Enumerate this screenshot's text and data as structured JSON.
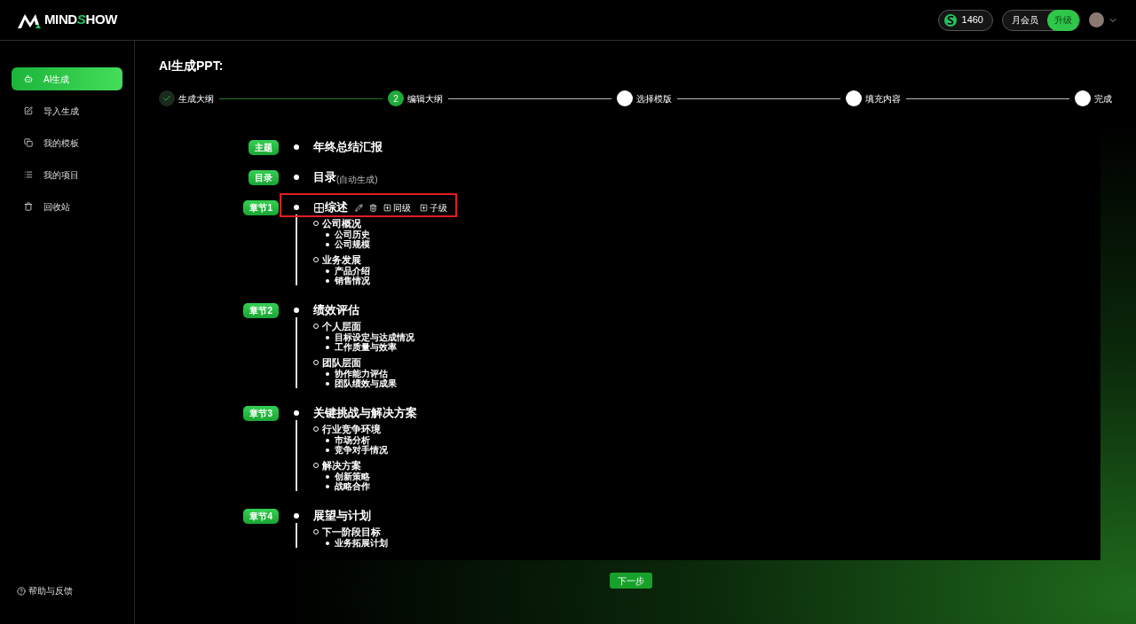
{
  "header": {
    "logo_text": "MINDSHOW",
    "coins": "1460",
    "membership": "月会员",
    "upgrade": "升级"
  },
  "sidebar": {
    "items": [
      {
        "label": "AI生成",
        "selected": true
      },
      {
        "label": "导入生成",
        "selected": false
      },
      {
        "label": "我的模板",
        "selected": false
      },
      {
        "label": "我的项目",
        "selected": false
      },
      {
        "label": "回收站",
        "selected": false
      }
    ],
    "help": "帮助与反馈"
  },
  "page_title": "AI生成PPT:",
  "steps": [
    {
      "label": "生成大纲",
      "kind": "done"
    },
    {
      "label": "编辑大纲",
      "number": "2",
      "kind": "current"
    },
    {
      "label": "选择模版",
      "kind": "todo"
    },
    {
      "label": "填充内容",
      "kind": "todo"
    },
    {
      "label": "完成",
      "kind": "todo"
    }
  ],
  "outline": [
    {
      "kind": "topic",
      "tag": "主题",
      "title": "年终总结汇报",
      "selected": false
    },
    {
      "kind": "toc",
      "tag": "目录",
      "title": "目录",
      "note": "(自动生成)",
      "selected": false
    },
    {
      "kind": "chapter",
      "tag": "章节1",
      "title": "综述",
      "selected": true,
      "children": [
        {
          "title": "公司概况",
          "children": [
            {
              "title": "公司历史"
            },
            {
              "title": "公司规模"
            }
          ]
        },
        {
          "title": "业务发展",
          "children": [
            {
              "title": "产品介绍"
            },
            {
              "title": "销售情况"
            }
          ]
        }
      ]
    },
    {
      "kind": "chapter",
      "tag": "章节2",
      "title": "绩效评估",
      "selected": false,
      "children": [
        {
          "title": "个人层面",
          "children": [
            {
              "title": "目标设定与达成情况"
            },
            {
              "title": "工作质量与效率"
            }
          ]
        },
        {
          "title": "团队层面",
          "children": [
            {
              "title": "协作能力评估"
            },
            {
              "title": "团队绩效与成果"
            }
          ]
        }
      ]
    },
    {
      "kind": "chapter",
      "tag": "章节3",
      "title": "关键挑战与解决方案",
      "selected": false,
      "children": [
        {
          "title": "行业竞争环境",
          "children": [
            {
              "title": "市场分析"
            },
            {
              "title": "竞争对手情况"
            }
          ]
        },
        {
          "title": "解决方案",
          "children": [
            {
              "title": "创新策略"
            },
            {
              "title": "战略合作"
            }
          ]
        }
      ]
    },
    {
      "kind": "chapter",
      "tag": "章节4",
      "title": "展望与计划",
      "selected": false,
      "children": [
        {
          "title": "下一阶段目标",
          "children": [
            {
              "title": "业务拓展计划"
            }
          ]
        }
      ]
    }
  ],
  "row_actions": [
    "同级",
    "子级"
  ],
  "next_button": "下一步"
}
